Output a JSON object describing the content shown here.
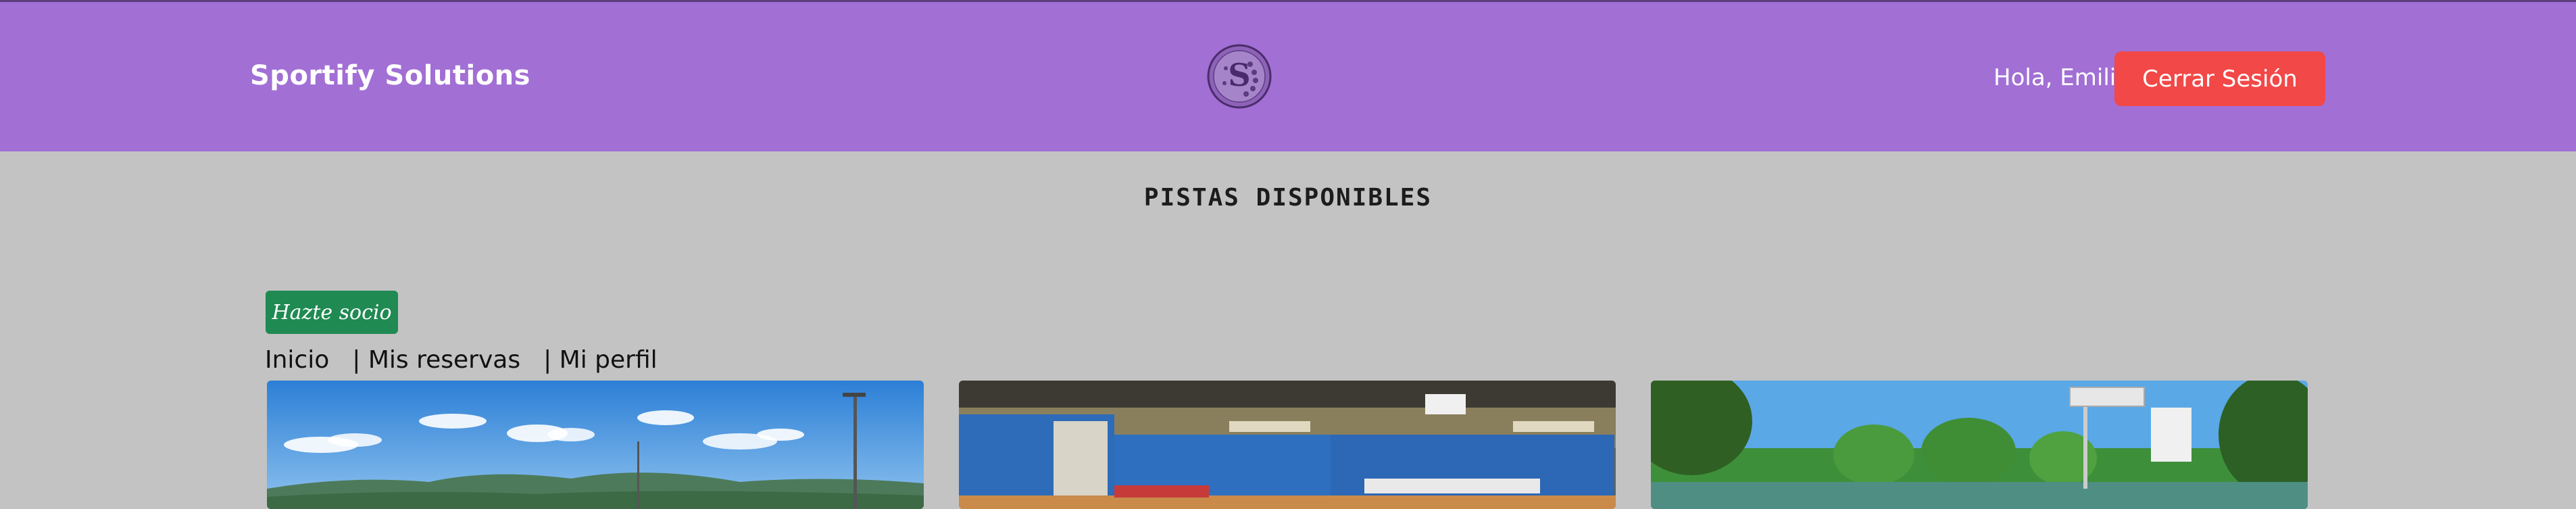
{
  "header": {
    "brand": "Sportify Solutions",
    "logo_icon": "sportify-logo-icon",
    "greeting": "Hola, Emilio",
    "logout_label": "Cerrar Sesión"
  },
  "main": {
    "title": "Pistas disponibles",
    "member_button_label": "Hazte socio",
    "nav": [
      {
        "label": "Inicio"
      },
      {
        "label": "| Mis reservas"
      },
      {
        "label": "| Mi perfil"
      }
    ],
    "courts": [
      {
        "image": "outdoor-court-image"
      },
      {
        "image": "indoor-arena-image"
      },
      {
        "image": "basketball-court-image"
      }
    ]
  },
  "colors": {
    "header_bg": "#a26fd5",
    "page_bg": "#c3c3c3",
    "logout_bg": "#f24848",
    "member_bg": "#1f8a52"
  }
}
